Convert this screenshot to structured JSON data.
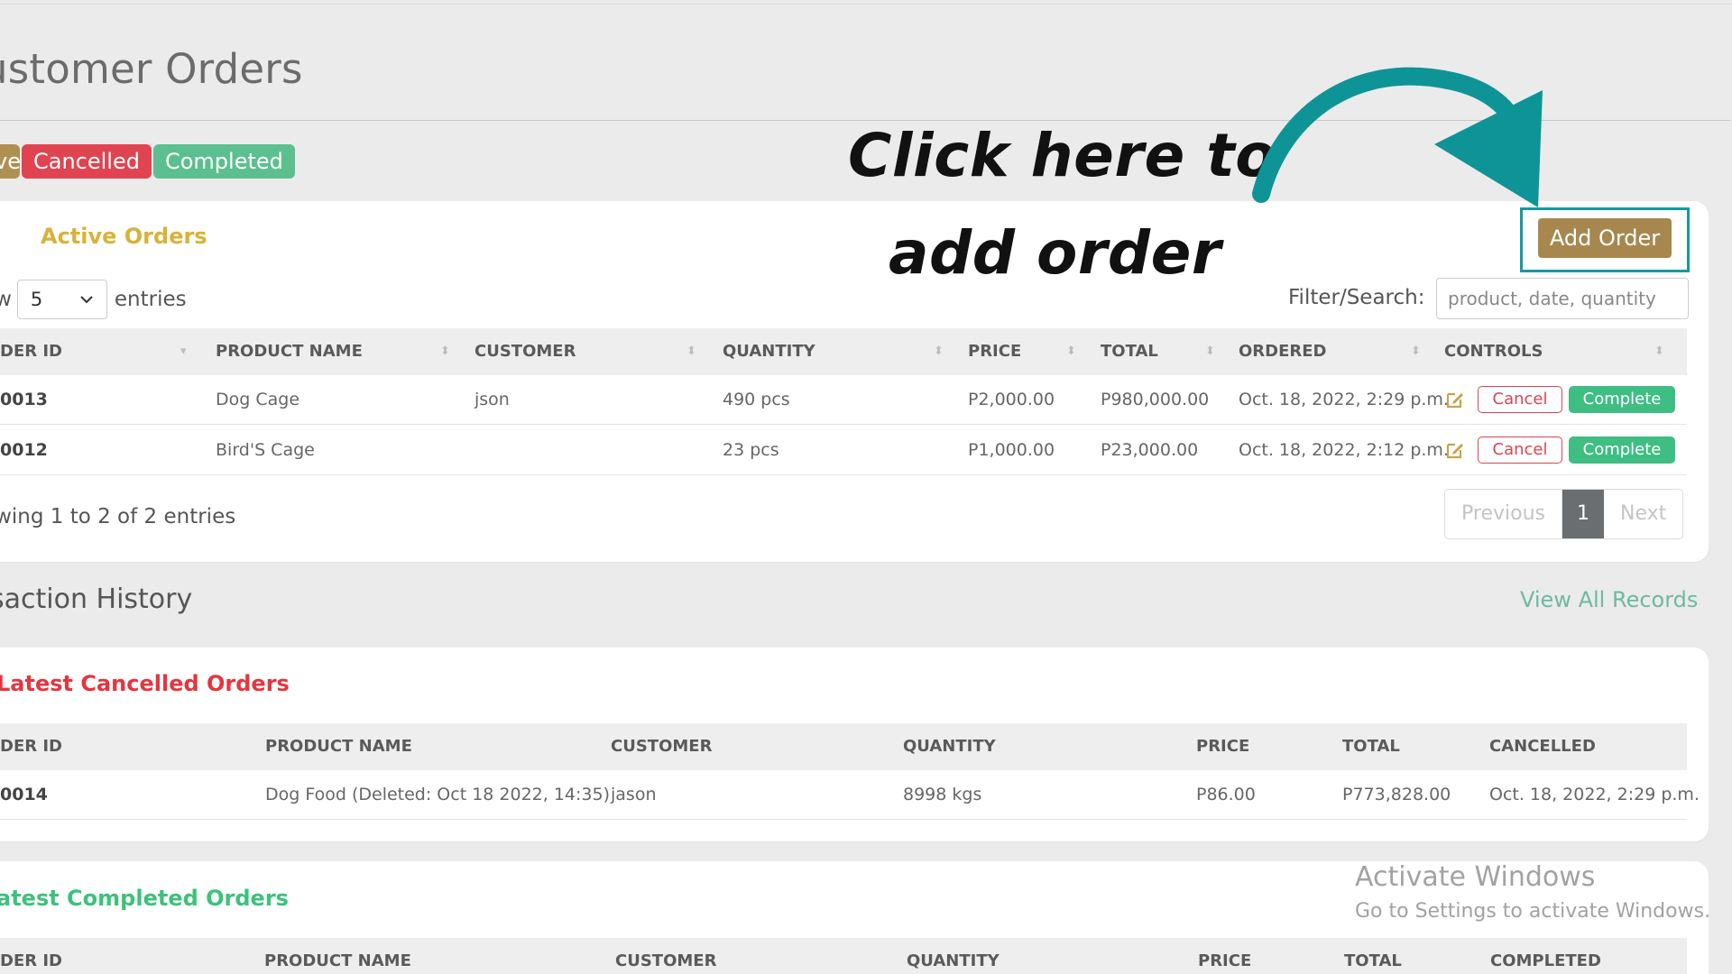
{
  "page": {
    "title": "ustomer Orders"
  },
  "status_tabs": {
    "active": "ve",
    "cancelled": "Cancelled",
    "completed": "Completed"
  },
  "callout": {
    "line1": "Click here to",
    "line2": "add order"
  },
  "active_orders": {
    "title": "Active Orders",
    "add_button": "Add Order",
    "show_prefix": "ow",
    "show_value": "5",
    "show_suffix": "entries",
    "filter_label": "Filter/Search:",
    "filter_placeholder": "product, date, quantity",
    "columns": [
      "DER ID",
      "PRODUCT NAME",
      "CUSTOMER",
      "QUANTITY",
      "PRICE",
      "TOTAL",
      "ORDERED",
      "CONTROLS"
    ],
    "rows": [
      {
        "id": "0013",
        "product": "Dog Cage",
        "customer": "json",
        "quantity": "490 pcs",
        "price": "P2,000.00",
        "total": "P980,000.00",
        "ordered": "Oct. 18, 2022, 2:29 p.m."
      },
      {
        "id": "0012",
        "product": "Bird'S Cage",
        "customer": "",
        "quantity": "23 pcs",
        "price": "P1,000.00",
        "total": "P23,000.00",
        "ordered": "Oct. 18, 2022, 2:12 p.m."
      }
    ],
    "row_actions": {
      "cancel": "Cancel",
      "complete": "Complete"
    },
    "info": "owing 1 to 2 of 2 entries",
    "pager": {
      "previous": "Previous",
      "current": "1",
      "next": "Next"
    }
  },
  "history": {
    "title": "nsaction History",
    "view_all": "View All Records"
  },
  "cancelled_orders": {
    "title": "Latest Cancelled Orders",
    "columns": [
      "DER ID",
      "PRODUCT NAME",
      "CUSTOMER",
      "QUANTITY",
      "PRICE",
      "TOTAL",
      "CANCELLED"
    ],
    "rows": [
      {
        "id": "0014",
        "product": "Dog Food (Deleted: Oct 18 2022, 14:35)",
        "customer": "jason",
        "quantity": "8998 kgs",
        "price": "P86.00",
        "total": "P773,828.00",
        "cancelled": "Oct. 18, 2022, 2:29 p.m."
      }
    ]
  },
  "completed_orders": {
    "title": "atest Completed Orders",
    "columns": [
      "DER ID",
      "PRODUCT NAME",
      "CUSTOMER",
      "QUANTITY",
      "PRICE",
      "TOTAL",
      "COMPLETED"
    ]
  },
  "watermark": {
    "line1": "Activate Windows",
    "line2": "Go to Settings to activate Windows."
  },
  "colors": {
    "accent_gold": "#a8874f",
    "cancel_red": "#e04450",
    "complete_green": "#3fbe83",
    "highlight_teal": "#139aa0"
  },
  "icons": {
    "edit": "edit-icon",
    "sort": "sort-icon",
    "dropdown": "chevron-down-icon",
    "arrow": "curved-arrow"
  }
}
